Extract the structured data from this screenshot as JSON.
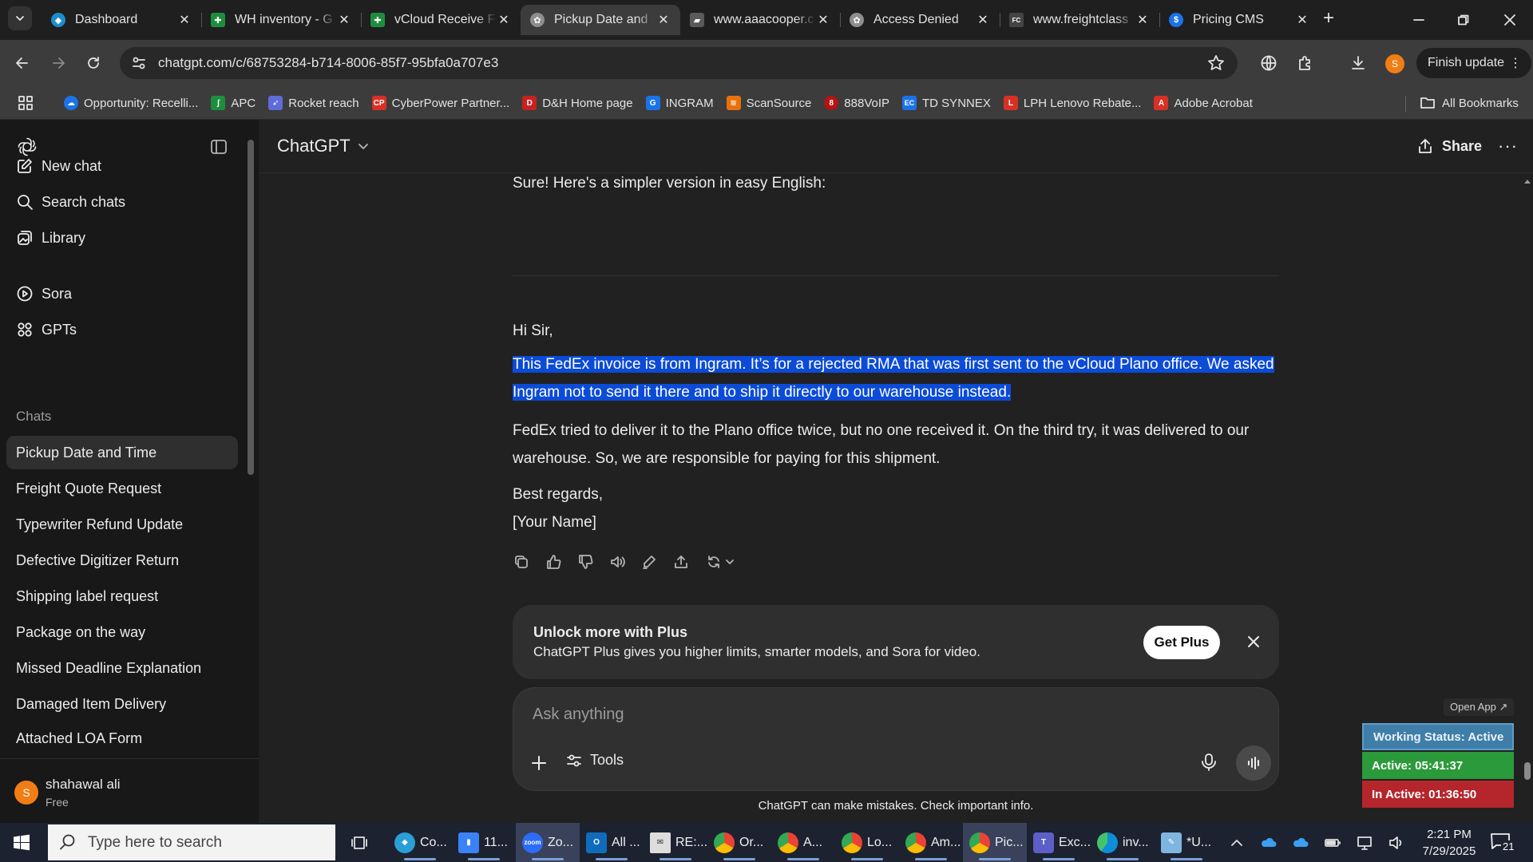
{
  "browser": {
    "tabs": [
      {
        "title": "Dashboard",
        "favicon_color": "#1c8ec9",
        "favicon": "dashboard-favicon",
        "active": false
      },
      {
        "title": "WH inventory - G",
        "favicon_color": "#1e8e3e",
        "favicon": "sheets-favicon",
        "active": false
      },
      {
        "title": "vCloud Receive F",
        "favicon_color": "#1e8e3e",
        "favicon": "sheets-favicon",
        "active": false
      },
      {
        "title": "Pickup Date and",
        "favicon_color": "#8e8e8e",
        "favicon": "chatgpt-favicon",
        "active": true
      },
      {
        "title": "www.aaacooper.c",
        "favicon_color": "#5a5a5a",
        "favicon": "truck-favicon",
        "active": false
      },
      {
        "title": "Access Denied",
        "favicon_color": "#8e8e8e",
        "favicon": "chatgpt-favicon",
        "active": false
      },
      {
        "title": "www.freightclass",
        "favicon_color": "#444444",
        "favicon": "fcc-favicon",
        "active": false
      },
      {
        "title": "Pricing CMS",
        "favicon_color": "#1a73e8",
        "favicon": "dollar-favicon",
        "active": false
      }
    ],
    "url": "chatgpt.com/c/68753284-b714-8006-85f7-95bfa0a707e3",
    "profile_initial": "S",
    "finish_update_label": "Finish update",
    "bookmarks": [
      {
        "label": "Opportunity: Recelli...",
        "color": "#1a73e8",
        "icon": "cloud-icon"
      },
      {
        "label": "APC",
        "color": "#1e8e3e",
        "icon": "apc-icon"
      },
      {
        "label": "Rocket reach",
        "color": "#5f6bd8",
        "icon": "rocket-icon"
      },
      {
        "label": "CyberPower Partner...",
        "color": "#d93025",
        "icon": "cp-icon"
      },
      {
        "label": "D&H Home page",
        "color": "#c5221f",
        "icon": "dh-icon"
      },
      {
        "label": "INGRAM",
        "color": "#1a73e8",
        "icon": "ingram-icon"
      },
      {
        "label": "ScanSource",
        "color": "#e8710a",
        "icon": "scansource-icon"
      },
      {
        "label": "888VoIP",
        "color": "#b31412",
        "icon": "voip-icon"
      },
      {
        "label": "TD SYNNEX",
        "color": "#1a73e8",
        "icon": "ec-icon"
      },
      {
        "label": "LPH Lenovo Rebate...",
        "color": "#d93025",
        "icon": "lenovo-icon"
      },
      {
        "label": "Adobe Acrobat",
        "color": "#d93025",
        "icon": "acrobat-icon"
      }
    ],
    "all_bookmarks_label": "All Bookmarks"
  },
  "sidebar": {
    "nav": [
      {
        "label": "New chat",
        "icon": "new-chat-icon"
      },
      {
        "label": "Search chats",
        "icon": "search-icon"
      },
      {
        "label": "Library",
        "icon": "library-icon"
      },
      {
        "label": "Sora",
        "icon": "sora-icon"
      },
      {
        "label": "GPTs",
        "icon": "gpts-icon"
      }
    ],
    "chats_heading": "Chats",
    "chats": [
      "Pickup Date and Time",
      "Freight Quote Request",
      "Typewriter Refund Update",
      "Defective Digitizer Return",
      "Shipping label request",
      "Package on the way",
      "Missed Deadline Explanation",
      "Damaged Item Delivery",
      "Attached LOA Form"
    ],
    "user": {
      "initial": "S",
      "name": "shahawal ali",
      "plan": "Free"
    }
  },
  "header": {
    "model": "ChatGPT",
    "share_label": "Share"
  },
  "conversation": {
    "intro": "Sure! Here's a simpler version in easy English:",
    "greeting": "Hi Sir,",
    "highlighted_paragraph": "This FedEx invoice is from Ingram. It’s for a rejected RMA that was first sent to the vCloud Plano office. We asked Ingram not to send it there and to ship it directly to our warehouse instead.",
    "paragraph2": "FedEx tried to deliver it to the Plano office twice, but no one received it. On the third try, it was delivered to our warehouse. So, we are responsible for paying for this shipment.",
    "closing": "Best regards,",
    "signature": "[Your Name]"
  },
  "plus_card": {
    "title": "Unlock more with Plus",
    "subtitle": "ChatGPT Plus gives you higher limits, smarter models, and Sora for video.",
    "button": "Get Plus"
  },
  "composer": {
    "placeholder": "Ask anything",
    "tools_label": "Tools"
  },
  "disclaimer": "ChatGPT can make mistakes. Check important info.",
  "status_widget": {
    "open_app": "Open App ↗",
    "working": "Working Status: Active",
    "active": "Active: 05:41:37",
    "inactive": "In Active: 01:36:50"
  },
  "taskbar": {
    "search_placeholder": "Type here to search",
    "apps": [
      {
        "label": "Co...",
        "color": "#2a9fd6",
        "active": false
      },
      {
        "label": "11...",
        "color": "#3b82f6",
        "active": false
      },
      {
        "label": "Zo...",
        "color": "#2d6cf6",
        "active": true
      },
      {
        "label": "All ...",
        "color": "#0f6cbd",
        "active": false
      },
      {
        "label": "RE:...",
        "color": "#dddddd",
        "active": false
      },
      {
        "label": "Or...",
        "color": "#e8453c",
        "active": false
      },
      {
        "label": "A...",
        "color": "#e8453c",
        "active": false
      },
      {
        "label": "Lo...",
        "color": "#e8453c",
        "active": false
      },
      {
        "label": "Am...",
        "color": "#e8453c",
        "active": false
      },
      {
        "label": "Pic...",
        "color": "#e8453c",
        "active": true
      },
      {
        "label": "Exc...",
        "color": "#5b5fc7",
        "active": false
      },
      {
        "label": "inv...",
        "color": "#0c8fd8",
        "active": false
      },
      {
        "label": "*U...",
        "color": "#7fb6e0",
        "active": false
      }
    ],
    "time": "2:21 PM",
    "date": "7/29/2025",
    "notification_count": "21"
  }
}
